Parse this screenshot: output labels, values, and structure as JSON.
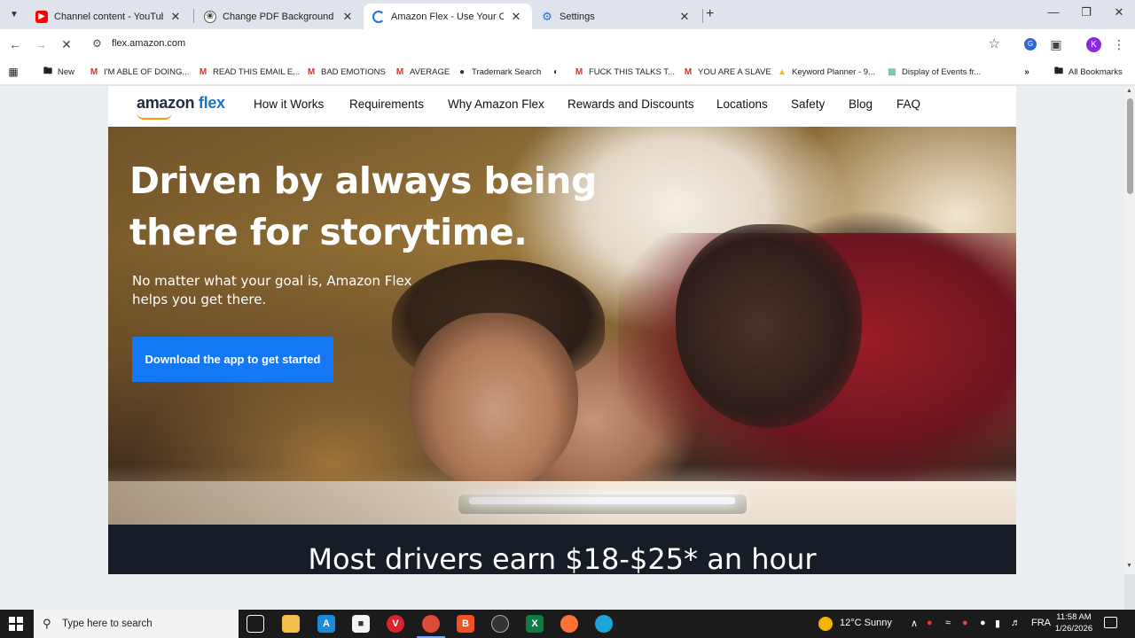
{
  "browser": {
    "tabs": [
      {
        "title": "Channel content - YouTube Studio",
        "icon": "youtube-icon",
        "active": false
      },
      {
        "title": "Change PDF Background",
        "icon": "openai-icon",
        "active": false
      },
      {
        "title": "Amazon Flex - Use Your Own Vehicle",
        "icon": "loading-icon",
        "active": true
      },
      {
        "title": "Settings",
        "icon": "gear-icon",
        "active": false
      }
    ],
    "url": "flex.amazon.com",
    "profile_initial": "K",
    "bookmarks": [
      {
        "label": "New",
        "icon": "folder-icon"
      },
      {
        "label": "I'M ABLE OF DOING...",
        "icon": "gmail-icon"
      },
      {
        "label": "READ THIS EMAIL E...",
        "icon": "gmail-icon"
      },
      {
        "label": "BAD EMOTIONS",
        "icon": "gmail-icon"
      },
      {
        "label": "AVERAGE",
        "icon": "gmail-icon"
      },
      {
        "label": "Trademark Search",
        "icon": "location-pin-icon"
      },
      {
        "label": "",
        "icon": "globe-icon"
      },
      {
        "label": "FUCK THIS TALKS T...",
        "icon": "gmail-icon"
      },
      {
        "label": "YOU ARE A SLAVE",
        "icon": "gmail-icon"
      },
      {
        "label": "Keyword Planner - 9...",
        "icon": "google-ads-icon"
      },
      {
        "label": "Display of Events fr...",
        "icon": "image-icon"
      }
    ],
    "all_bookmarks": "All Bookmarks"
  },
  "site": {
    "logo_text": "amazon",
    "logo_flex": "flex",
    "nav": [
      "How it Works",
      "Requirements",
      "Why Amazon Flex",
      "Rewards and Discounts",
      "Locations",
      "Safety",
      "Blog",
      "FAQ"
    ],
    "hero": {
      "headline": "Driven by always being there for storytime.",
      "sub": "No matter what your goal is, Amazon Flex helps you get there.",
      "cta": "Download the app to get started"
    },
    "earn": "Most drivers earn $18-$25* an hour"
  },
  "taskbar": {
    "search_placeholder": "Type here to search",
    "weather": "12°C  Sunny",
    "language": "FRA",
    "time": "11:58 AM",
    "date": "1/26/2026"
  },
  "colors": {
    "cta": "#1478f5",
    "flex_blue": "#1a73c8",
    "earn_band": "#161d26"
  }
}
